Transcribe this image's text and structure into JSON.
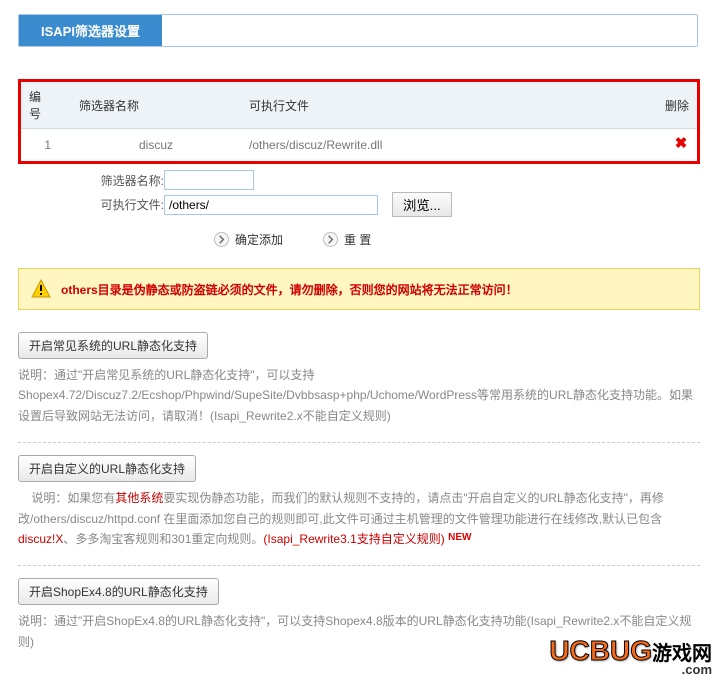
{
  "title": "ISAPI筛选器设置",
  "table": {
    "headers": {
      "num": "编号",
      "name": "筛选器名称",
      "file": "可执行文件",
      "del": "删除"
    },
    "row": {
      "num": "1",
      "name": "discuz",
      "file": "/others/discuz/Rewrite.dll"
    }
  },
  "form": {
    "name_label": "筛选器名称:",
    "file_label": "可执行文件:",
    "name_value": "",
    "file_value": "/others/",
    "browse": "浏览..."
  },
  "actions": {
    "add": "确定添加",
    "reset": "重 置"
  },
  "alert": "others目录是伪静态或防盗链必须的文件，请勿删除，否则您的网站将无法正常访问！",
  "sections": [
    {
      "button": "开启常见系统的URL静态化支持",
      "desc_plain": "说明：通过\"开启常见系统的URL静态化支持\"，可以支持 Shopex4.72/Discuz7.2/Ecshop/Phpwind/SupeSite/Dvbbsasp+php/Uchome/WordPress等常用系统的URL静态化支持功能。如果设置后导致网站无法访问，请取消！(Isapi_Rewrite2.x不能自定义规则)"
    },
    {
      "button": "开启自定义的URL静态化支持",
      "desc_pre": "说明：如果您有",
      "sys": "其他系统",
      "desc_mid": "要实现伪静态功能，而我们的默认规则不支持的，请点击\"开启自定义的URL静态化支持\"，再修改/others/discuz/httpd.conf 在里面添加您自己的规则即可,此文件可通过主机管理的文件管理功能进行在线修改,默认已包含",
      "discuz": "discuz!X",
      "desc_mid2": "、多多淘宝客规则和301重定向规则。",
      "isapi": "(Isapi_Rewrite3.1支持自定义规则)",
      "new": "NEW"
    },
    {
      "button": "开启ShopEx4.8的URL静态化支持",
      "desc_plain": "说明：通过\"开启ShopEx4.8的URL静态化支持\"，可以支持Shopex4.8版本的URL静态化支持功能(Isapi_Rewrite2.x不能自定义规则)"
    }
  ],
  "watermark": {
    "a": "UCBUG",
    "b": "游戏网",
    "c": ".com"
  }
}
